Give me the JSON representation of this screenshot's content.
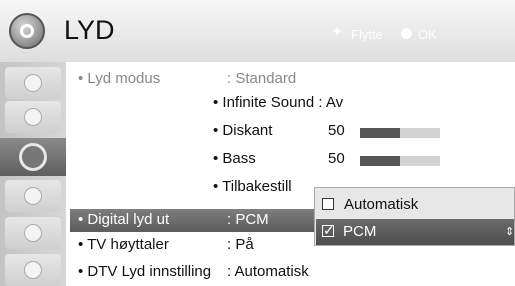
{
  "header": {
    "title": "LYD",
    "hint_move": "Flytte",
    "hint_ok": "OK"
  },
  "sidebar": {
    "icons": [
      "picture-icon",
      "screen-icon",
      "audio-icon",
      "clock-icon",
      "lock-icon",
      "option-icon"
    ],
    "active_index": 2
  },
  "menu": {
    "rows": [
      {
        "label": "• Lyd modus",
        "value": ": Standard",
        "dim": true
      },
      {
        "label": "• Digital lyd ut",
        "value": ": PCM",
        "selected": true
      },
      {
        "label": "• TV høyttaler",
        "value": ": På"
      },
      {
        "label": "• DTV Lyd innstilling",
        "value": ": Automatisk"
      }
    ],
    "subrows": [
      {
        "label": "• Infinite Sound : Av"
      },
      {
        "label": "• Diskant",
        "value": "50",
        "level": 0.5
      },
      {
        "label": "• Bass",
        "value": "50",
        "level": 0.5
      },
      {
        "label": "• Tilbakestill"
      }
    ]
  },
  "popup": {
    "options": [
      {
        "label": "Automatisk",
        "checked": false
      },
      {
        "label": "PCM",
        "checked": true
      }
    ]
  }
}
